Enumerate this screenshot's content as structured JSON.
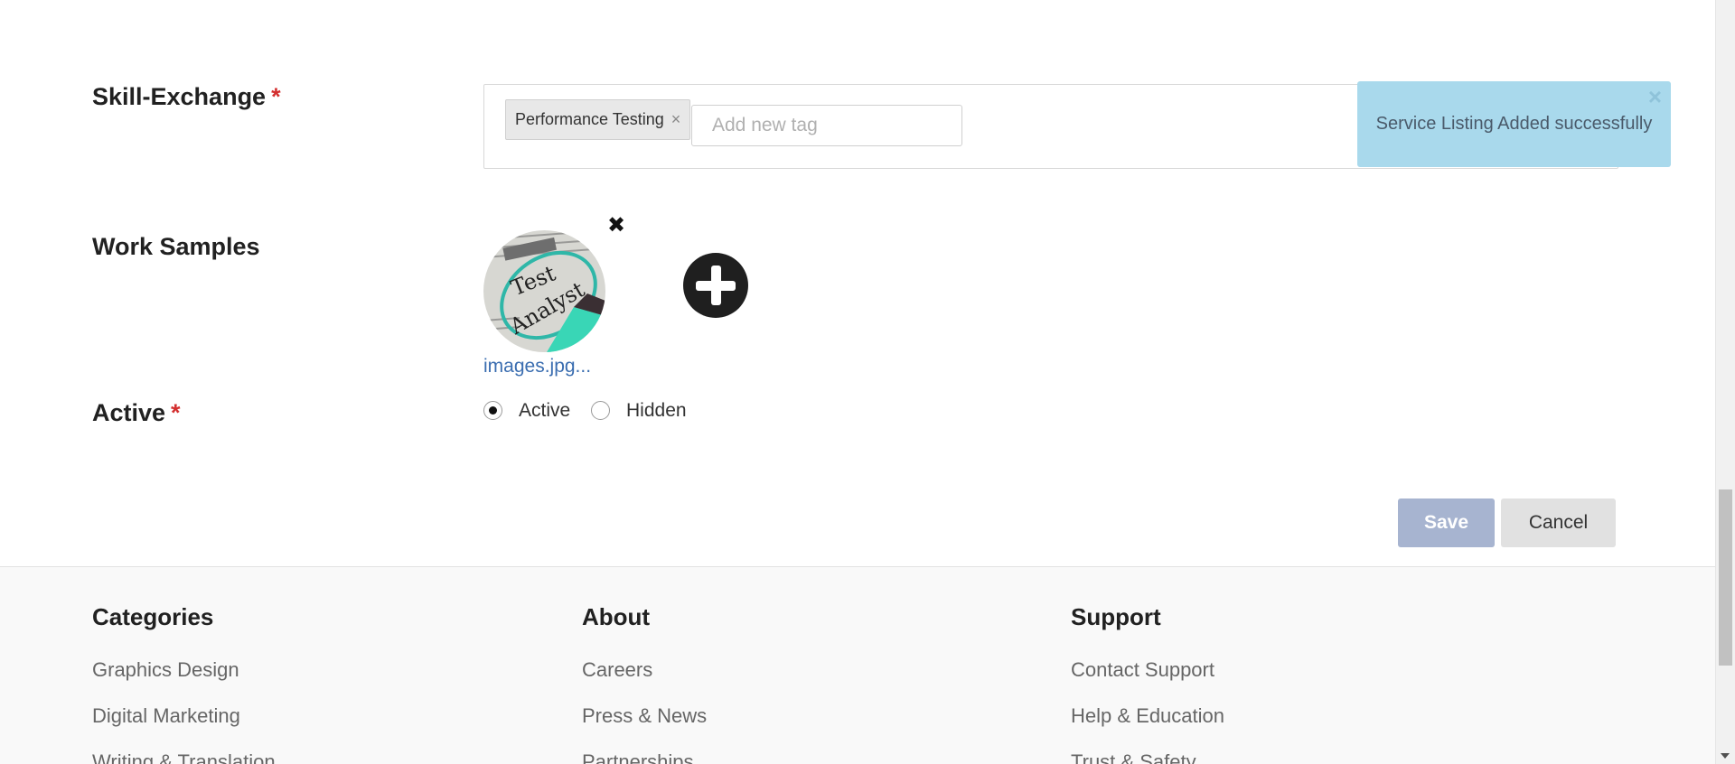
{
  "form": {
    "skill_exchange": {
      "label": "Skill-Exchange",
      "required_mark": "*",
      "tags": [
        "Performance Testing"
      ],
      "tag_remove_glyph": "×",
      "input_placeholder": "Add new tag"
    },
    "work_samples": {
      "label": "Work Samples",
      "remove_glyph": "✖",
      "file_name": "images.jpg...",
      "thumbnail_text_top": "Test",
      "thumbnail_text_bottom": "Analyst",
      "add_icon": "plus-circle-icon"
    },
    "active": {
      "label": "Active",
      "required_mark": "*",
      "options": [
        {
          "label": "Active",
          "checked": true
        },
        {
          "label": "Hidden",
          "checked": false
        }
      ]
    },
    "buttons": {
      "save": "Save",
      "cancel": "Cancel"
    }
  },
  "toast": {
    "message": "Service Listing Added successfully",
    "close_glyph": "×"
  },
  "footer": {
    "columns": [
      {
        "heading": "Categories",
        "links": [
          "Graphics Design",
          "Digital Marketing",
          "Writing & Translation"
        ]
      },
      {
        "heading": "About",
        "links": [
          "Careers",
          "Press & News",
          "Partnerships"
        ]
      },
      {
        "heading": "Support",
        "links": [
          "Contact Support",
          "Help & Education",
          "Trust & Safety"
        ]
      }
    ]
  },
  "colors": {
    "toast_bg": "#a9d9ec",
    "save_bg": "#a7b4d0",
    "required": "#d32f2f",
    "link": "#3a6db0"
  }
}
